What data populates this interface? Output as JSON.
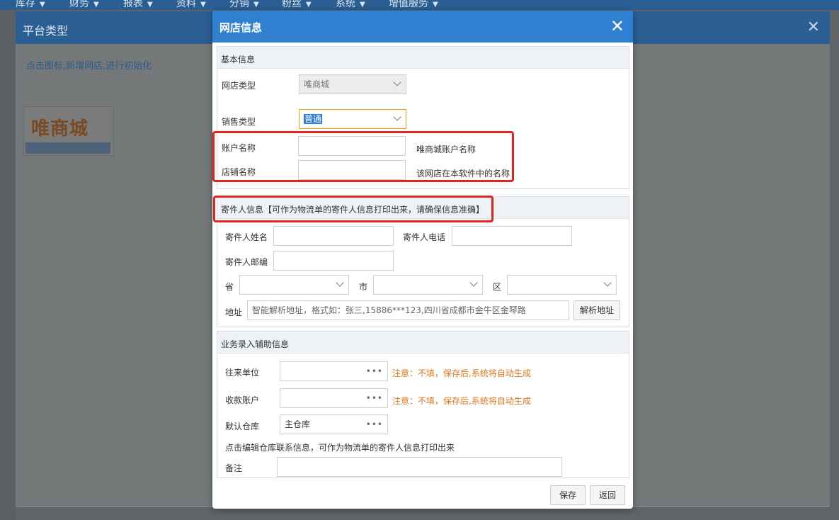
{
  "top_nav": {
    "items": [
      "库存",
      "财务",
      "报表",
      "资料",
      "分销",
      "粉丝",
      "系统",
      "增值服务"
    ]
  },
  "background_dialog": {
    "title": "平台类型",
    "hint": "点击图标,新增网店,进行初始化",
    "logo_text": "唯商城"
  },
  "modal": {
    "title": "网店信息",
    "close_icon": "close-icon",
    "basic": {
      "title": "基本信息",
      "shop_type_label": "网店类型",
      "shop_type_value": "唯商城",
      "sales_type_label": "销售类型",
      "sales_type_value": "普通",
      "account_label": "账户名称",
      "account_hint": "唯商城账户名称",
      "store_label": "店铺名称",
      "store_hint": "该网店在本软件中的名称"
    },
    "sender": {
      "title": "寄件人信息【可作为物流单的寄件人信息打印出来，请确保信息准确】",
      "name_label": "寄件人姓名",
      "phone_label": "寄件人电话",
      "zip_label": "寄件人邮编",
      "province_label": "省",
      "city_label": "市",
      "district_label": "区",
      "address_label": "地址",
      "address_placeholder": "智能解析地址，格式如：张三,15886***123,四川省成都市金牛区金琴路",
      "parse_button": "解析地址"
    },
    "business": {
      "title": "业务录入辅助信息",
      "partner_label": "往来单位",
      "partner_note": "注意：不填，保存后,系统将自动生成",
      "account_label": "收款账户",
      "account_note": "注意：不填，保存后,系统将自动生成",
      "warehouse_label": "默认仓库",
      "warehouse_value": "主仓库",
      "warehouse_hint": "点击编辑仓库联系信息，可作为物流单的寄件人信息打印出来",
      "remark_label": "备注"
    },
    "buttons": {
      "save": "保存",
      "back": "返回"
    }
  },
  "colors": {
    "header_blue": "#2f80d1",
    "warning_orange": "#e2761d",
    "highlight_red": "#e3241d",
    "focus_border": "#f0a30a"
  }
}
